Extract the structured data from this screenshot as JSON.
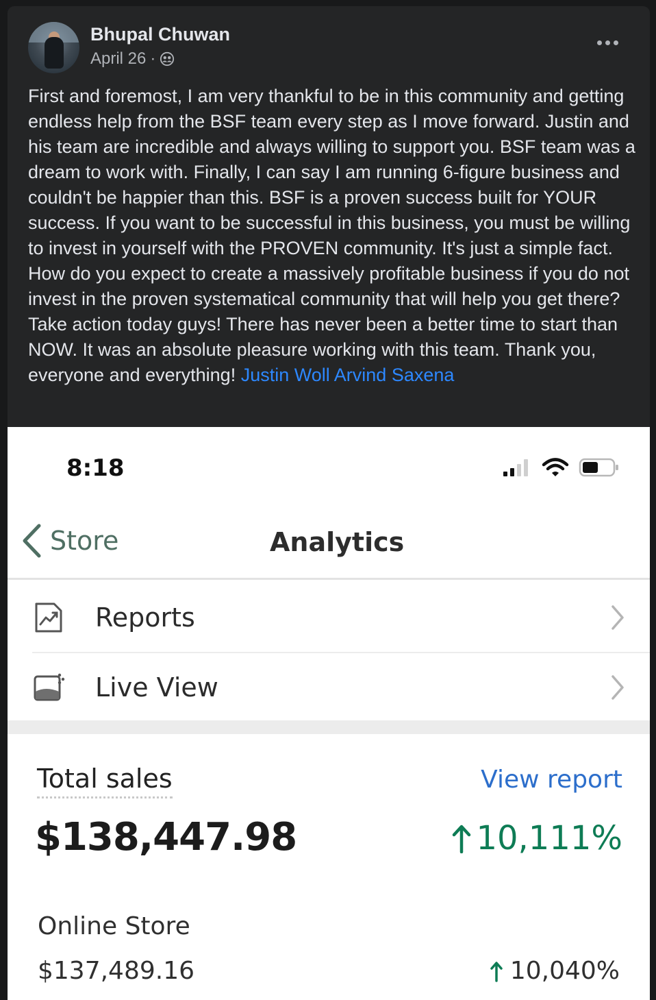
{
  "post": {
    "author": "Bhupal Chuwan",
    "date": "April 26",
    "separator": "·",
    "privacy_icon": "friends-icon",
    "more_icon": "more-horizontal-icon",
    "text": "First and foremost, I am very thankful to be in this community and getting endless help from the BSF team every step as I move forward. Justin and his team are incredible and always willing to support you. BSF team was a dream to work with. Finally, I can say I am running 6-figure business and couldn't be happier than this. BSF is a proven success built for YOUR success. If you want to be successful in this business, you must be willing to invest in yourself with the PROVEN community. It's just a simple fact. How do you expect to create a massively profitable business if you do not invest in the proven systematical community that will help you get there? Take action today guys! There has never been a better time to start than NOW. It was an absolute pleasure working with this team. Thank you, everyone and everything!",
    "tags": [
      "Justin Woll",
      "Arvind Saxena"
    ]
  },
  "screenshot": {
    "status_time": "8:18",
    "back_label": "Store",
    "title": "Analytics",
    "menu": [
      {
        "label": "Reports",
        "icon": "reports-icon"
      },
      {
        "label": "Live View",
        "icon": "live-view-icon"
      }
    ],
    "total_sales_label": "Total sales",
    "view_report_label": "View report",
    "total_sales_value": "$138,447.98",
    "total_sales_change": "10,111%",
    "online_store_label": "Online Store",
    "online_store_value": "$137,489.16",
    "online_store_change": "10,040%",
    "colors": {
      "positive": "#0e7c55",
      "link": "#2c6ecb",
      "fb_link": "#2d88ff"
    }
  }
}
